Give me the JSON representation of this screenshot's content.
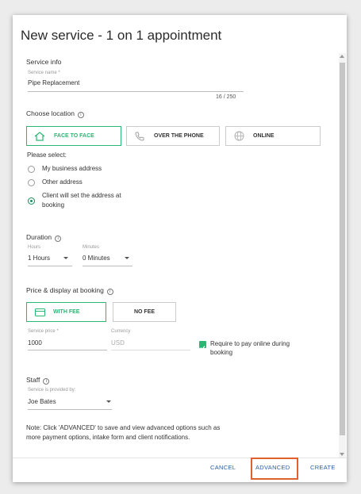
{
  "dialog": {
    "title": "New service - 1 on 1 appointment"
  },
  "service_info": {
    "section_title": "Service info",
    "name_label": "Service name *",
    "name_value": "Pipe Replacement",
    "char_count": "16 / 250"
  },
  "location": {
    "section_title": "Choose location",
    "options": [
      {
        "label": "FACE TO FACE",
        "icon": "home-icon",
        "selected": true
      },
      {
        "label": "OVER THE PHONE",
        "icon": "phone-icon",
        "selected": false
      },
      {
        "label": "ONLINE",
        "icon": "globe-icon",
        "selected": false
      }
    ],
    "please_select": "Please select:",
    "address_options": [
      {
        "label": "My business address",
        "checked": false
      },
      {
        "label": "Other address",
        "checked": false
      },
      {
        "label_line1": "Client will set the address at",
        "label_line2": "booking",
        "checked": true
      }
    ]
  },
  "duration": {
    "section_title": "Duration",
    "hours_label": "Hours",
    "hours_value": "1 Hours",
    "minutes_label": "Minutes",
    "minutes_value": "0 Minutes"
  },
  "price": {
    "section_title": "Price & display at booking",
    "with_fee_label": "WITH FEE",
    "no_fee_label": "NO FEE",
    "service_price_label": "Service price *",
    "service_price_value": "1000",
    "currency_label": "Currency",
    "currency_value": "USD",
    "require_online_line1": "Require to pay online during",
    "require_online_line2": "booking",
    "require_online_checked": true
  },
  "staff": {
    "section_title": "Staff",
    "provided_by_label": "Service is provided by:",
    "provided_by_value": "Joe Bates"
  },
  "note": {
    "line1": "Note: Click 'ADVANCED' to save and view advanced options such as",
    "line2": "more payment options, intake form and client notifications."
  },
  "footer": {
    "cancel_label": "CANCEL",
    "advanced_label": "ADVANCED",
    "create_label": "CREATE"
  },
  "colors": {
    "accent_green": "#2bb673",
    "link_blue": "#2b5fa3",
    "highlight_orange": "#e0622b"
  }
}
